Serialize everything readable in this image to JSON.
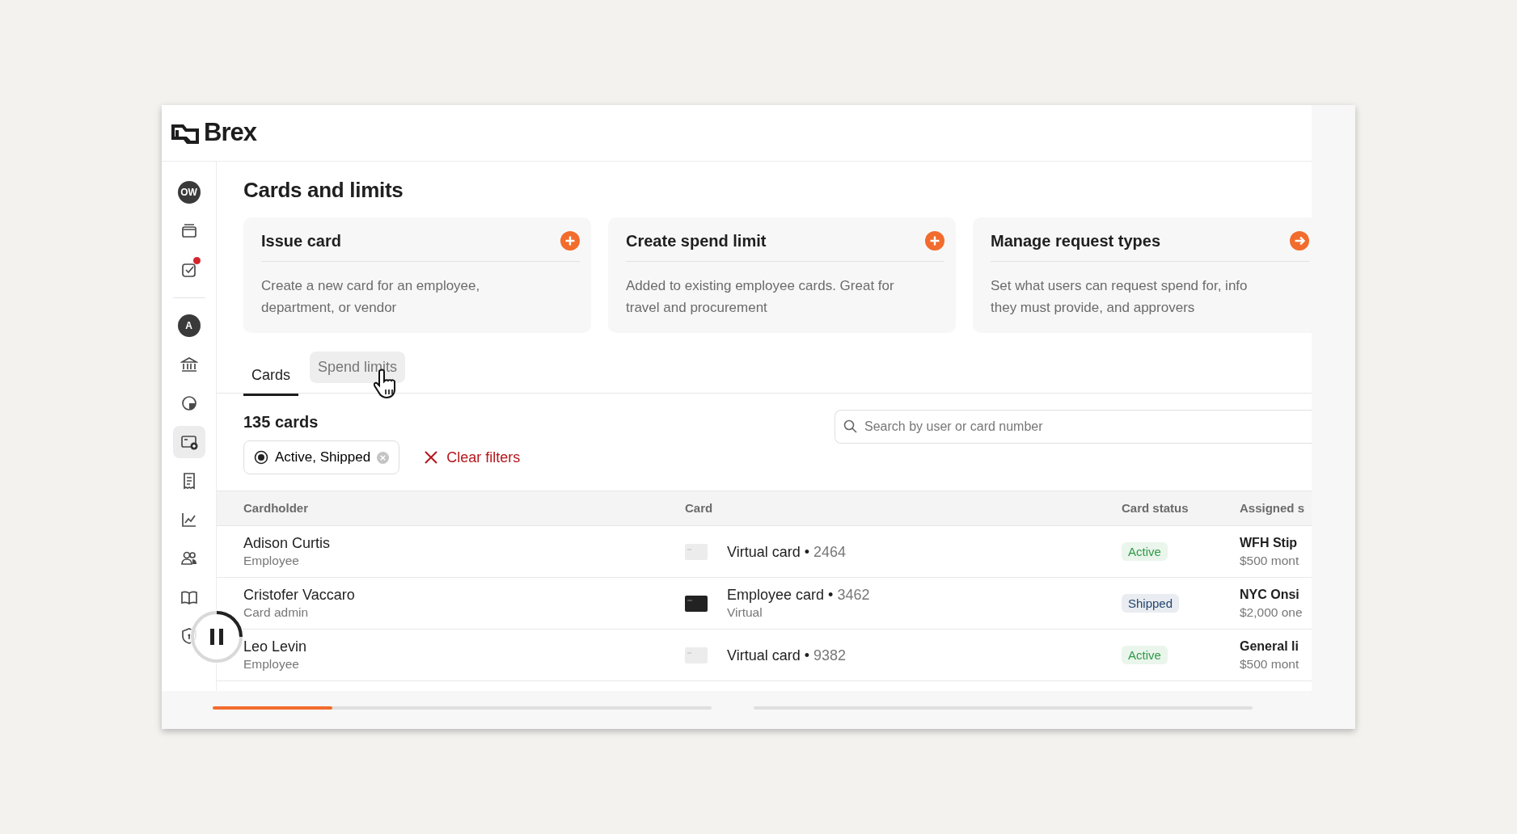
{
  "logo": {
    "wordmark": "Brex"
  },
  "sidebar": {
    "items": [
      {
        "kind": "avatar",
        "text": "OW",
        "selected": false,
        "badge": false
      },
      {
        "kind": "wallet",
        "selected": false,
        "badge": false
      },
      {
        "kind": "tasks",
        "selected": false,
        "badge": true
      },
      {
        "kind": "divider"
      },
      {
        "kind": "avatar",
        "text": "A",
        "selected": false,
        "badge": false
      },
      {
        "kind": "bank",
        "selected": false,
        "badge": false
      },
      {
        "kind": "pie",
        "selected": false,
        "badge": false
      },
      {
        "kind": "cards",
        "selected": true,
        "badge": false
      },
      {
        "kind": "receipt",
        "selected": false,
        "badge": false
      },
      {
        "kind": "chart",
        "selected": false,
        "badge": false
      },
      {
        "kind": "people",
        "selected": false,
        "badge": false
      },
      {
        "kind": "book",
        "selected": false,
        "badge": false
      },
      {
        "kind": "shield",
        "selected": false,
        "badge": false
      }
    ]
  },
  "page": {
    "title": "Cards and limits"
  },
  "actions": [
    {
      "title": "Issue card",
      "kind": "add",
      "description": "Create a new card for an employee, department, or vendor"
    },
    {
      "title": "Create spend limit",
      "kind": "add",
      "description": "Added to existing employee cards. Great for travel and procurement"
    },
    {
      "title": "Manage request types",
      "kind": "go",
      "description": "Set what users can request spend for, info they must provide, and approvers"
    }
  ],
  "tabs": [
    {
      "label": "Cards",
      "selected": true,
      "hovered": false
    },
    {
      "label": "Spend limits",
      "selected": false,
      "hovered": true
    }
  ],
  "count": "135 cards",
  "search": {
    "placeholder": "Search by user or card number"
  },
  "filter": {
    "label": "Active, Shipped"
  },
  "clear_filters": "Clear filters",
  "table": {
    "columns": [
      "Cardholder",
      "Card",
      "Card status",
      "Assigned s"
    ],
    "rows": [
      {
        "name": "Adison Curtis",
        "role": "Employee",
        "kind": "virtual",
        "card": "Virtual card •",
        "last4": "2464",
        "card_sub": "",
        "status": "Active",
        "color": "#2f9a47",
        "assigned": "WFH Stip",
        "amount": "$500 mont"
      },
      {
        "name": "Cristofer Vaccaro",
        "role": "Card admin",
        "kind": "physical",
        "card": "Employee card •",
        "last4": "3462",
        "card_sub": "Virtual",
        "status": "Shipped",
        "color": "#23456e",
        "assigned": "NYC Onsi",
        "amount": "$2,000 one"
      },
      {
        "name": "Leo Levin",
        "role": "Employee",
        "kind": "virtual",
        "card": "Virtual card •",
        "last4": "9382",
        "card_sub": "",
        "status": "Active",
        "color": "#2f9a47",
        "assigned": "General li",
        "amount": "$500 mont"
      }
    ]
  },
  "video": {
    "playing": true,
    "progress": [
      {
        "level": 0.24
      },
      {
        "level": 0
      }
    ]
  }
}
